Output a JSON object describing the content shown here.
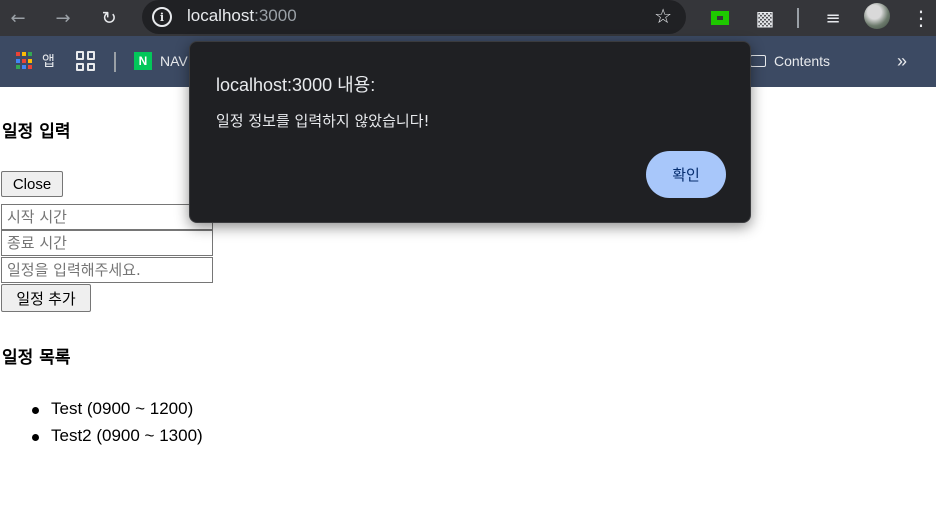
{
  "browser": {
    "url_host": "localhost",
    "url_port": ":3000",
    "back_icon": "arrow-left-icon",
    "forward_icon": "arrow-right-icon",
    "reload_icon": "reload-icon",
    "info_icon": "info-icon",
    "star_icon": "star-icon"
  },
  "bookmarks": {
    "apps_label": "앱",
    "naver_label": "NAV",
    "contents_label": "Contents"
  },
  "page": {
    "schedule_input_heading": "일정 입력",
    "close_button": "Close",
    "start_time_placeholder": "시작 시간",
    "end_time_placeholder": "종료 시간",
    "schedule_placeholder": "일정을 입력해주세요.",
    "add_button": "일정 추가",
    "schedule_list_heading": "일정 목록",
    "schedule_items": [
      "Test (0900 ~ 1200)",
      "Test2 (0900 ~ 1300)"
    ]
  },
  "dialog": {
    "title": "localhost:3000 내용:",
    "message": "일정 정보를 입력하지 않았습니다!",
    "ok_button": "확인"
  },
  "colors": {
    "toolbar_bg": "#35363a",
    "bookmarks_bg": "#3c4a63",
    "dialog_bg": "#1f2023",
    "ok_button_bg": "#a8c7fa"
  }
}
